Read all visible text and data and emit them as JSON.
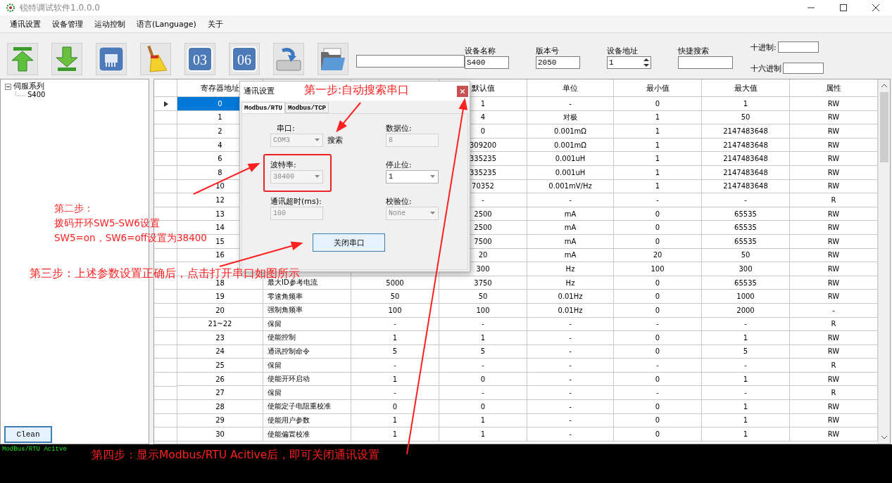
{
  "window": {
    "title": "锐特调试软件1.0.0.0"
  },
  "menu": [
    "通讯设置",
    "设备管理",
    "运动控制",
    "语言(Language)",
    "关于"
  ],
  "toolbar": {
    "buttons": [
      {
        "kind": "upload"
      },
      {
        "kind": "download"
      },
      {
        "kind": "chip"
      },
      {
        "kind": "broom"
      },
      {
        "kind": "number",
        "label": "03"
      },
      {
        "kind": "number",
        "label": "06"
      },
      {
        "kind": "drive"
      },
      {
        "kind": "folder"
      }
    ],
    "fields": [
      {
        "label": "设备名称",
        "value": "S400",
        "kind": "text"
      },
      {
        "label": "版本号",
        "value": "2050",
        "kind": "text"
      },
      {
        "label": "设备地址",
        "value": "1",
        "kind": "spin"
      },
      {
        "label": "快捷搜索",
        "kind": "text"
      }
    ],
    "radix": [
      {
        "label": "十进制:"
      },
      {
        "label": "十六进制"
      }
    ]
  },
  "tree": [
    {
      "label": "伺服系列",
      "expanded": true,
      "children": [
        {
          "label": "S400"
        }
      ]
    }
  ],
  "clean_button": "Clean",
  "table": {
    "columns": [
      "寄存器地址",
      null,
      null,
      "默认值",
      "单位",
      "最小值",
      "最大值",
      "属性"
    ],
    "rows": [
      {
        "selected": true,
        "cells": [
          "0",
          null,
          null,
          "1",
          "-",
          "0",
          "1",
          "RW"
        ]
      },
      {
        "selected": false,
        "cells": [
          "1",
          null,
          null,
          "4",
          "对极",
          "1",
          "50",
          "RW"
        ]
      },
      {
        "selected": false,
        "cells": [
          "2",
          null,
          null,
          "0",
          "0.001mΩ",
          "1",
          "2147483648",
          "RW"
        ]
      },
      {
        "selected": false,
        "cells": [
          "4",
          null,
          null,
          "309200",
          "0.001mΩ",
          "1",
          "2147483648",
          "RW"
        ]
      },
      {
        "selected": false,
        "cells": [
          "6",
          null,
          null,
          "335235",
          "0.001uH",
          "1",
          "2147483648",
          "RW"
        ]
      },
      {
        "selected": false,
        "cells": [
          "8",
          null,
          null,
          "335235",
          "0.001uH",
          "1",
          "2147483648",
          "RW"
        ]
      },
      {
        "selected": false,
        "cells": [
          "10",
          null,
          null,
          "70352",
          "0.001mV/Hz",
          "1",
          "2147483648",
          "RW"
        ]
      },
      {
        "selected": false,
        "cells": [
          "12",
          null,
          null,
          "-",
          "-",
          "-",
          "-",
          "R"
        ]
      },
      {
        "selected": false,
        "cells": [
          "13",
          null,
          null,
          "2500",
          "mA",
          "0",
          "65535",
          "RW"
        ]
      },
      {
        "selected": false,
        "cells": [
          "14",
          null,
          null,
          "2500",
          "mA",
          "0",
          "65535",
          "RW"
        ]
      },
      {
        "selected": false,
        "cells": [
          "15",
          null,
          null,
          "7500",
          "mA",
          "0",
          "65535",
          "RW"
        ]
      },
      {
        "selected": false,
        "cells": [
          "16",
          null,
          null,
          "20",
          "mA",
          "20",
          "50",
          "RW"
        ]
      },
      {
        "selected": false,
        "cells": [
          null,
          null,
          null,
          "300",
          "Hz",
          "100",
          "300",
          "RW"
        ]
      },
      {
        "selected": false,
        "cells": [
          "18",
          "最大ID参考电流",
          "5000",
          "3750",
          "Hz",
          "0",
          "65535",
          "RW"
        ]
      },
      {
        "selected": false,
        "cells": [
          "19",
          "零速角频率",
          "50",
          "50",
          "0.01Hz",
          "0",
          "1000",
          "RW"
        ]
      },
      {
        "selected": false,
        "cells": [
          "20",
          "强制角频率",
          "100",
          "100",
          "0.01Hz",
          "0",
          "2000",
          "-"
        ]
      },
      {
        "selected": false,
        "cells": [
          "21~22",
          "保留",
          "-",
          "-",
          "-",
          "-",
          "-",
          "R"
        ]
      },
      {
        "selected": false,
        "cells": [
          "23",
          "使能控制",
          "1",
          "1",
          "-",
          "0",
          "1",
          "RW"
        ]
      },
      {
        "selected": false,
        "cells": [
          "24",
          "通讯控制命令",
          "5",
          "5",
          "-",
          "0",
          "5",
          "RW"
        ]
      },
      {
        "selected": false,
        "cells": [
          "25",
          "保留",
          "-",
          "-",
          "-",
          "-",
          "-",
          "R"
        ]
      },
      {
        "selected": false,
        "cells": [
          "26",
          "使能开环启动",
          "1",
          "0",
          "-",
          "0",
          "1",
          "RW"
        ]
      },
      {
        "selected": false,
        "cells": [
          "27",
          "保留",
          "-",
          "-",
          "-",
          "-",
          "-",
          "R"
        ]
      },
      {
        "selected": false,
        "cells": [
          "28",
          "使能定子电阻重校准",
          "0",
          "0",
          "-",
          "0",
          "1",
          "RW"
        ]
      },
      {
        "selected": false,
        "cells": [
          "29",
          "使能用户参数",
          "1",
          "1",
          "-",
          "0",
          "1",
          "RW"
        ]
      },
      {
        "selected": false,
        "cells": [
          "30",
          "使能偏置校准",
          "1",
          "1",
          "-",
          "0",
          "1",
          "RW"
        ]
      }
    ]
  },
  "dialog": {
    "title": "通讯设置",
    "tabs": [
      {
        "label": "Modbus/RTU",
        "selected": true
      },
      {
        "label": "Modbus/TCP",
        "selected": false
      }
    ],
    "fields": [
      {
        "label": "串口:",
        "value": "COM3",
        "kind": "select",
        "disabled": true,
        "action": "搜索"
      },
      {
        "label": "数据位:",
        "value": "8",
        "kind": "text",
        "disabled": true
      },
      {
        "label": "波特率:",
        "value": "38400",
        "kind": "select",
        "disabled": true
      },
      {
        "label": "停止位:",
        "value": "1",
        "kind": "select",
        "disabled": false
      },
      {
        "label": "通讯超时(ms):",
        "value": "100",
        "kind": "text",
        "disabled": true
      },
      {
        "label": "校验位:",
        "value": "None",
        "kind": "select",
        "disabled": true
      }
    ],
    "button": "关闭串口"
  },
  "console": {
    "lines": [
      "ModBus/RTU Acitve"
    ]
  },
  "annotations": [
    {
      "lines": [
        "第一步:自动搜索串口"
      ]
    },
    {
      "lines": [
        "第二步：",
        "拨码开环SW5-SW6设置",
        "SW5=on，SW6=off设置为38400"
      ]
    },
    {
      "lines": [
        "第三步：上述参数设置正确后，点击打开串口如图所示"
      ]
    },
    {
      "lines": [
        "第四步：显示Modbus/RTU Acitive后，即可关闭通讯设置"
      ]
    }
  ]
}
